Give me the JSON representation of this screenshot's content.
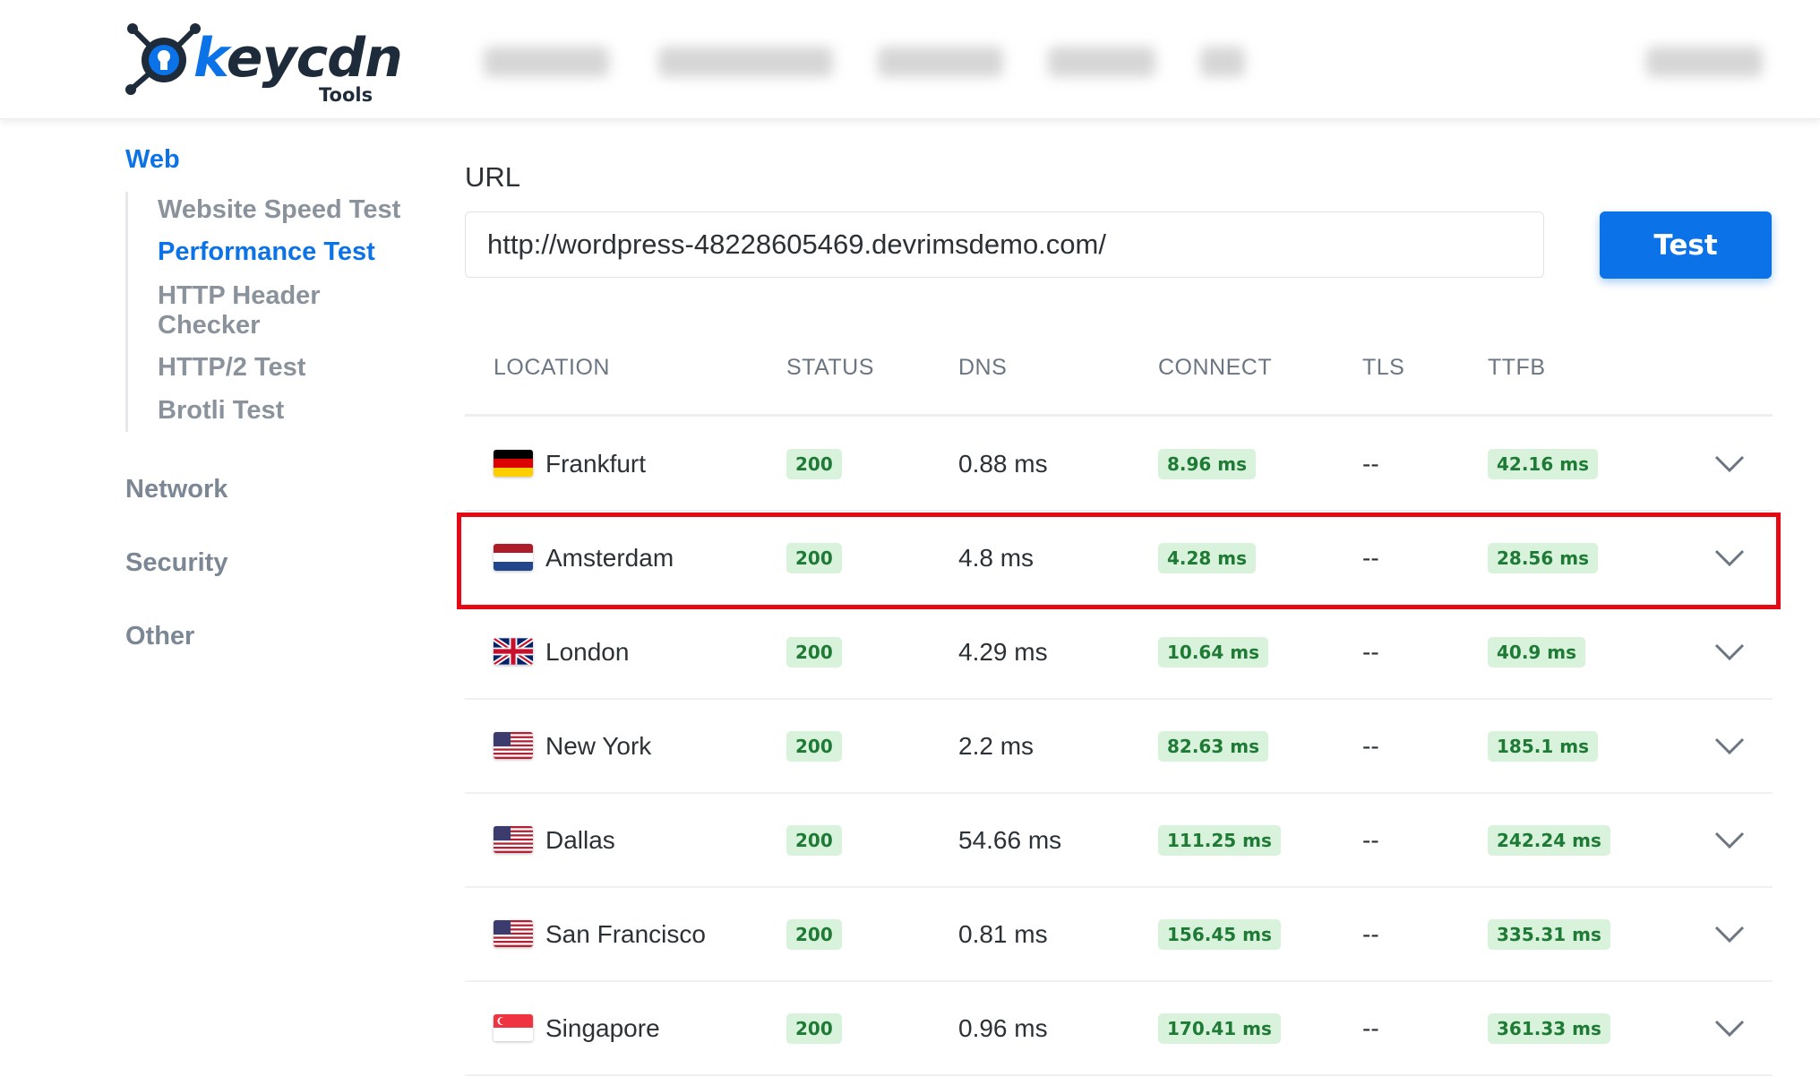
{
  "logo": {
    "word_k": "k",
    "word_rest": "eycdn",
    "sub": "Tools",
    "brand_color": "#0b72e7"
  },
  "sidebar": {
    "web_heading": "Web",
    "web_items": [
      {
        "label": "Website Speed Test",
        "active": false
      },
      {
        "label": "Performance Test",
        "active": true
      },
      {
        "label": "HTTP Header Checker",
        "active": false
      },
      {
        "label": "HTTP/2 Test",
        "active": false
      },
      {
        "label": "Brotli Test",
        "active": false
      }
    ],
    "categories": [
      "Network",
      "Security",
      "Other"
    ]
  },
  "form": {
    "url_label": "URL",
    "url_value": "http://wordpress-48228605469.devrimsdemo.com/",
    "test_button": "Test"
  },
  "table": {
    "headers": {
      "location": "LOCATION",
      "status": "STATUS",
      "dns": "DNS",
      "connect": "CONNECT",
      "tls": "TLS",
      "ttfb": "TTFB"
    },
    "rows": [
      {
        "flag": "de-flag",
        "location": "Frankfurt",
        "status": "200",
        "dns": "0.88 ms",
        "connect": "8.96 ms",
        "tls": "--",
        "ttfb": "42.16 ms"
      },
      {
        "flag": "nl-flag",
        "location": "Amsterdam",
        "status": "200",
        "dns": "4.8 ms",
        "connect": "4.28 ms",
        "tls": "--",
        "ttfb": "28.56 ms"
      },
      {
        "flag": "gb-flag",
        "location": "London",
        "status": "200",
        "dns": "4.29 ms",
        "connect": "10.64 ms",
        "tls": "--",
        "ttfb": "40.9 ms"
      },
      {
        "flag": "us-flag",
        "location": "New York",
        "status": "200",
        "dns": "2.2 ms",
        "connect": "82.63 ms",
        "tls": "--",
        "ttfb": "185.1 ms"
      },
      {
        "flag": "us-flag",
        "location": "Dallas",
        "status": "200",
        "dns": "54.66 ms",
        "connect": "111.25 ms",
        "tls": "--",
        "ttfb": "242.24 ms"
      },
      {
        "flag": "us-flag",
        "location": "San Francisco",
        "status": "200",
        "dns": "0.81 ms",
        "connect": "156.45 ms",
        "tls": "--",
        "ttfb": "335.31 ms"
      },
      {
        "flag": "sg-flag",
        "location": "Singapore",
        "status": "200",
        "dns": "0.96 ms",
        "connect": "170.41 ms",
        "tls": "--",
        "ttfb": "361.33 ms"
      }
    ]
  },
  "colors": {
    "highlight": "#e50914",
    "badge_bg": "#d8f2dc",
    "badge_text": "#1e7a34"
  }
}
